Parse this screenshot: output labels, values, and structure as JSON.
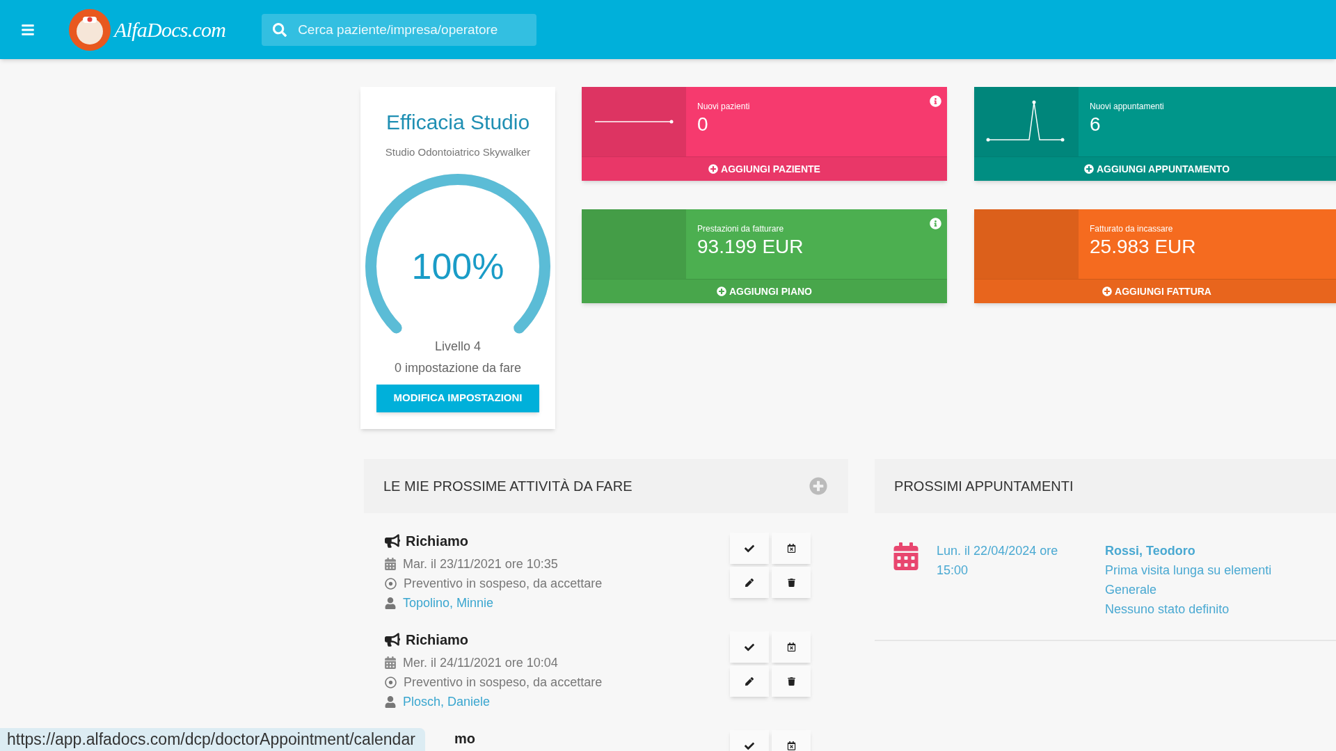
{
  "top_bar": {
    "logo": "AlfaDocs.com",
    "search": {
      "placeholder": "Cerca paziente/impresa/operatore"
    }
  },
  "efficacy_card": {
    "title": "Efficacia Studio",
    "subtitle": "Studio Odontoiatrico Skywalker",
    "gauge": {
      "level": 1,
      "reading": "100%"
    },
    "level_text": "Livello 4",
    "pending": "0 impostazione da fare",
    "button": "MODIFICA IMPOSTAZIONI"
  },
  "stat_cards": [
    {
      "label": "Nuovi pazienti",
      "value": "0",
      "action": "AGGIUNGI PAZIENTE",
      "color": "#f63a6e",
      "info": true,
      "kind": "flat"
    },
    {
      "label": "Nuovi appuntamenti",
      "value": "6",
      "action": "AGGIUNGI APPUNTAMENTO",
      "color": "#00968a",
      "info": false,
      "kind": "spike"
    },
    {
      "label": "Prestazioni da fatturare",
      "value": "93.199 EUR",
      "action": "AGGIUNGI PIANO",
      "color": "#4caf50",
      "info": true,
      "kind": "plain"
    },
    {
      "label": "Fatturato da incassare",
      "value": "25.983 EUR",
      "action": "AGGIUNGI FATTURA",
      "color": "#f56b1f",
      "info": false,
      "kind": "plain"
    }
  ],
  "tasks": {
    "title": "LE MIE PROSSIME ATTIVITÀ DA FARE",
    "items": [
      {
        "title": "Richiamo",
        "kind": "task",
        "date": "Mar. il 23/11/2021 ore 10:35",
        "status": "Preventivo in sospeso, da accettare",
        "patient": "Topolino, Minnie"
      },
      {
        "title": "Richiamo",
        "kind": "task",
        "date": "Mer. il 24/11/2021 ore 10:04",
        "status": "Preventivo in sospeso, da accettare",
        "patient": "Plosch, Daniele"
      },
      {
        "title": "mo",
        "kind": "partial"
      }
    ]
  },
  "appointments": {
    "title": "PROSSIMI APPUNTAMENTI",
    "items": [
      {
        "date": "Lun. il 22/04/2024 ore 15:00",
        "patient": "Rossi, Teodoro",
        "details": [
          "Prima visita lunga su elementi",
          "Generale",
          "Nessuno stato definito"
        ]
      }
    ]
  },
  "status_bar": {
    "url": "https://app.alfadocs.com/dcp/doctorAppointment/calendar"
  }
}
